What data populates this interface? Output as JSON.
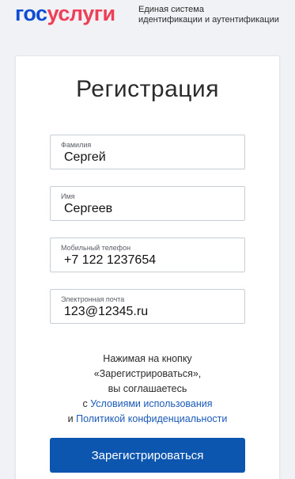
{
  "header": {
    "logo_part1": "гос",
    "logo_part2": "услуги",
    "tagline_line1": "Единая система",
    "tagline_line2": "идентификации и аутентификации"
  },
  "form": {
    "title": "Регистрация",
    "fields": [
      {
        "label": "Фамилия",
        "value": "Сергей"
      },
      {
        "label": "Имя",
        "value": "Сергеев"
      },
      {
        "label": "Мобильный телефон",
        "value": "+7 122 1237654"
      },
      {
        "label": "Электронная почта",
        "value": "123@12345.ru"
      }
    ],
    "terms": {
      "line1": "Нажимая на кнопку",
      "line2": "«Зарегистрироваться»,",
      "line3": "вы соглашаетесь",
      "prefix_with": "с ",
      "terms_link": "Условиями использования",
      "prefix_and": "и ",
      "privacy_link": "Политикой конфиденциальности"
    },
    "submit_label": "Зарегистрироваться"
  },
  "colors": {
    "brand_blue": "#0d4cd3",
    "brand_red": "#ee3f58",
    "button_blue": "#0d56b0",
    "link_blue": "#1a5ab8"
  }
}
